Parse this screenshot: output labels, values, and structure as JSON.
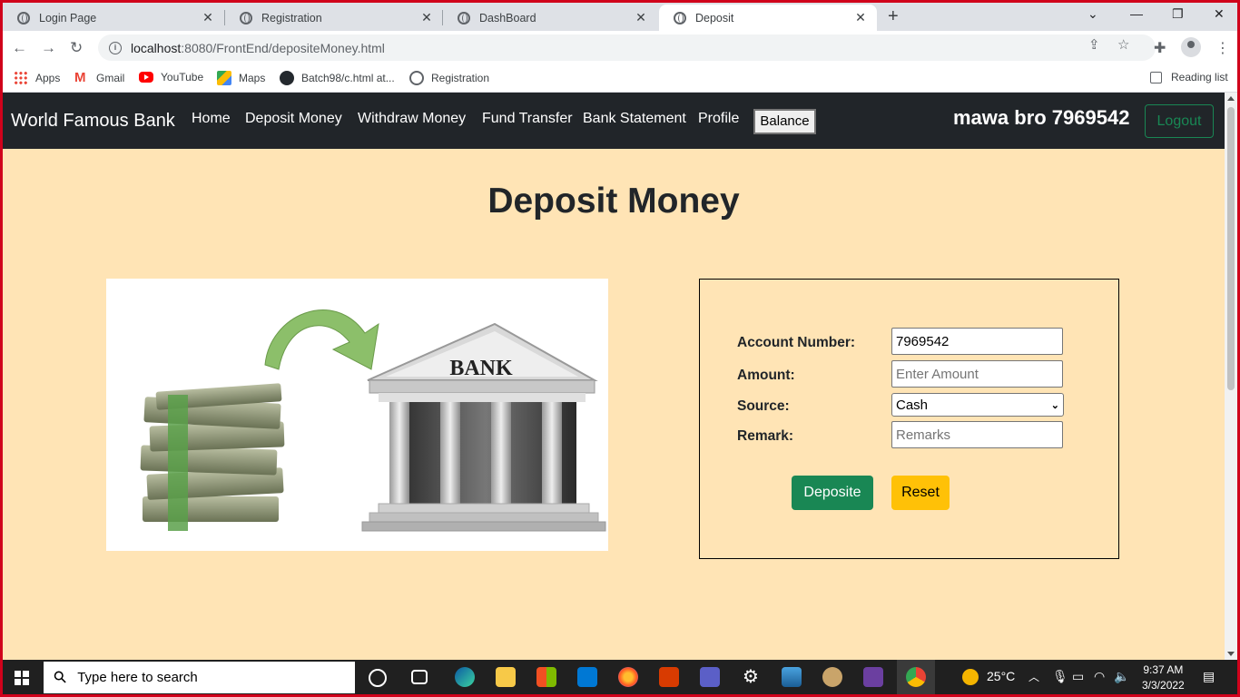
{
  "browser": {
    "tabs": [
      {
        "title": "Login Page"
      },
      {
        "title": "Registration"
      },
      {
        "title": "DashBoard"
      },
      {
        "title": "Deposit"
      }
    ],
    "url_host": "localhost",
    "url_rest": ":8080/FrontEnd/depositeMoney.html",
    "bookmarks": [
      "Apps",
      "Gmail",
      "YouTube",
      "Maps",
      "Batch98/c.html at...",
      "Registration"
    ],
    "reading_list": "Reading list"
  },
  "site": {
    "brand": "World Famous Bank",
    "nav": [
      "Home",
      "Deposit Money",
      "Withdraw Money",
      "Fund Transfer",
      "Bank Statement",
      "Profile"
    ],
    "balance_label": "Balance",
    "user": "mawa bro 7969542",
    "logout_label": "Logout"
  },
  "page": {
    "title": "Deposit Money",
    "illustration_text": "BANK"
  },
  "form": {
    "account_label": "Account Number:",
    "account_value": "7969542",
    "amount_label": "Amount:",
    "amount_placeholder": "Enter Amount",
    "source_label": "Source:",
    "source_value": "Cash",
    "remark_label": "Remark:",
    "remark_placeholder": "Remarks",
    "deposit_label": "Deposite",
    "reset_label": "Reset"
  },
  "taskbar": {
    "search_placeholder": "Type here to search",
    "temperature": "25°C",
    "time": "9:37 AM",
    "date": "3/3/2022"
  }
}
